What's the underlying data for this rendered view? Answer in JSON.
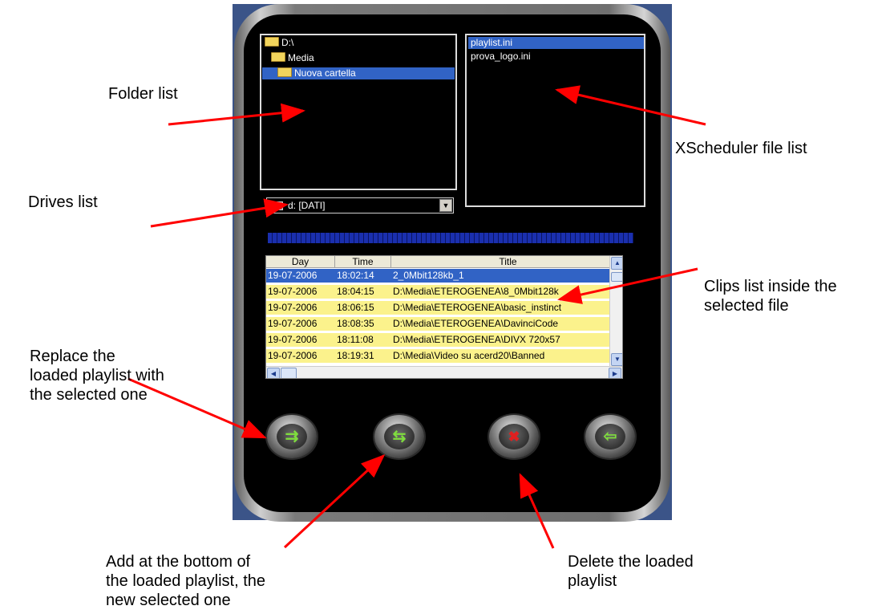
{
  "folders": [
    {
      "label": "D:\\",
      "selected": false
    },
    {
      "label": "Media",
      "selected": false
    },
    {
      "label": "Nuova cartella",
      "selected": true
    }
  ],
  "files": [
    {
      "label": "playlist.ini",
      "selected": true
    },
    {
      "label": "prova_logo.ini",
      "selected": false
    }
  ],
  "drive": {
    "label": "d: [DATI]",
    "icon": "drive-icon"
  },
  "clips": {
    "headers": [
      "Day",
      "Time",
      "Title"
    ],
    "rows": [
      {
        "day": "19-07-2006",
        "time": "18:02:14",
        "title": "2_0Mbit128kb_1",
        "selected": true
      },
      {
        "day": "19-07-2006",
        "time": "18:04:15",
        "title": "D:\\Media\\ETEROGENEA\\8_0Mbit128k",
        "selected": false
      },
      {
        "day": "19-07-2006",
        "time": "18:06:15",
        "title": "D:\\Media\\ETEROGENEA\\basic_instinct",
        "selected": false
      },
      {
        "day": "19-07-2006",
        "time": "18:08:35",
        "title": "D:\\Media\\ETEROGENEA\\DavinciCode",
        "selected": false
      },
      {
        "day": "19-07-2006",
        "time": "18:11:08",
        "title": "D:\\Media\\ETEROGENEA\\DIVX 720x57",
        "selected": false
      },
      {
        "day": "19-07-2006",
        "time": "18:19:31",
        "title": "D:\\Media\\Video su acerd20\\Banned",
        "selected": false
      }
    ]
  },
  "buttons": [
    {
      "name": "replace-playlist-button",
      "icon": "replace-icon"
    },
    {
      "name": "add-playlist-button",
      "icon": "add-icon"
    },
    {
      "name": "delete-playlist-button",
      "icon": "delete-icon"
    },
    {
      "name": "exit-button",
      "icon": "exit-icon"
    }
  ],
  "annotations": {
    "folder_list": "Folder list",
    "drives_list": "Drives list",
    "file_list": "XScheduler file list",
    "clips_list": [
      "Clips list inside the",
      "selected file"
    ],
    "replace": [
      "Replace the",
      "loaded playlist with",
      "the selected one"
    ],
    "add": [
      "Add at the bottom of",
      "the loaded playlist, the",
      "new selected one"
    ],
    "delete": [
      "Delete the loaded",
      "playlist"
    ]
  },
  "colors": {
    "arrow": "#ff0000",
    "selection": "#3163c5",
    "clip_row": "#fbf28c",
    "progress": "#1a2fae"
  }
}
